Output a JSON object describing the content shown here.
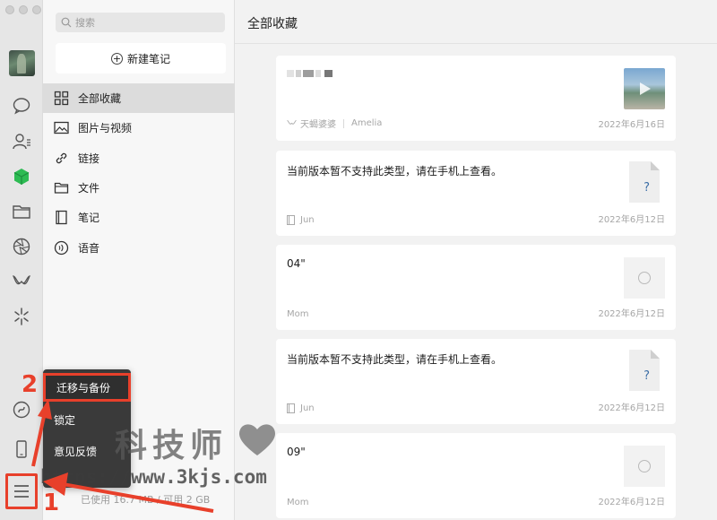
{
  "search": {
    "placeholder": "搜索",
    "icon": "search-icon"
  },
  "sidebar": {
    "new_note_label": "新建笔记"
  },
  "categories": [
    {
      "label": "全部收藏",
      "icon": "grid-icon",
      "active": true
    },
    {
      "label": "图片与视频",
      "icon": "image-icon",
      "active": false
    },
    {
      "label": "链接",
      "icon": "link-icon",
      "active": false
    },
    {
      "label": "文件",
      "icon": "folder-icon",
      "active": false
    },
    {
      "label": "笔记",
      "icon": "notebook-icon",
      "active": false
    },
    {
      "label": "语音",
      "icon": "voice-icon",
      "active": false
    }
  ],
  "popup_menu": {
    "items": [
      "迁移与备份",
      "锁定",
      "意见反馈"
    ],
    "highlighted": "迁移与备份",
    "truncated": "设"
  },
  "storage_text": "已使用 16.7 MB / 可用 2 GB",
  "main": {
    "title": "全部收藏",
    "cards": [
      {
        "text": "",
        "source": "天蝎婆婆",
        "author": "Amelia",
        "date": "2022年6月16日",
        "thumb": "image"
      },
      {
        "text": "当前版本暂不支持此类型，请在手机上查看。",
        "source": "Jun",
        "date": "2022年6月12日",
        "thumb": "doc"
      },
      {
        "text": "04\"",
        "source": "Mom",
        "date": "2022年6月12日",
        "thumb": "voice"
      },
      {
        "text": "当前版本暂不支持此类型，请在手机上查看。",
        "source": "Jun",
        "date": "2022年6月12日",
        "thumb": "doc"
      },
      {
        "text": "09\"",
        "source": "Mom",
        "date": "2022年6月12日",
        "thumb": "voice"
      }
    ]
  },
  "annotations": {
    "step1": "1",
    "step2": "2"
  },
  "watermark": {
    "title": "科技师",
    "url": "https://www.3kjs.com"
  },
  "colors": {
    "annotation_red": "#e8402b",
    "active_bg": "#dcdcdc",
    "menu_bg": "#3a3a3a",
    "wechat_green": "#2dbb53"
  }
}
